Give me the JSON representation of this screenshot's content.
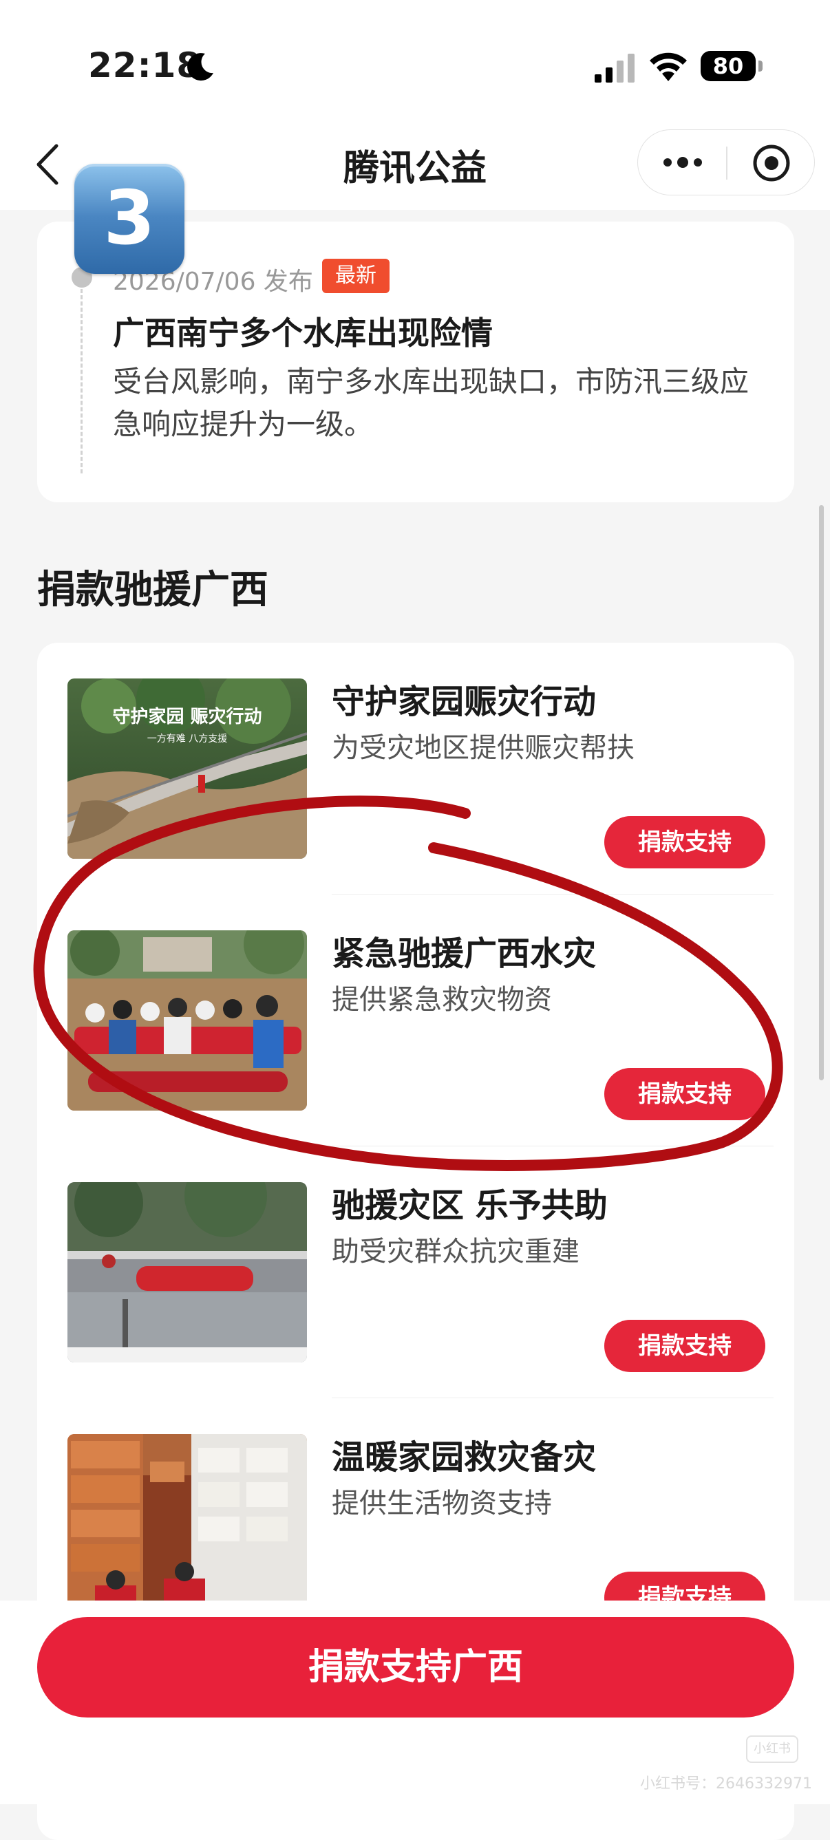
{
  "status_bar": {
    "time": "22:18",
    "battery": "80",
    "icons": [
      "moon-icon",
      "signal-icon",
      "wifi-icon",
      "battery-icon"
    ]
  },
  "nav": {
    "title": "腾讯公益",
    "icons": [
      "back-icon",
      "more-icon",
      "close-icon"
    ]
  },
  "step_badge": "3",
  "news": {
    "date": "2026/07/06 发布",
    "tag": "最新",
    "title": "广西南宁多个水库出现险情",
    "description": "受台风影响，南宁多水库出现缺口，市防汛三级应急响应提升为一级。"
  },
  "section": {
    "title": "捐款驰援广西"
  },
  "projects": [
    {
      "title": "守护家园赈灾行动",
      "subtitle": "为受灾地区提供赈灾帮扶",
      "button": "捐款支持",
      "thumb_caption": "守护家园 赈灾行动",
      "thumb_subcaption": "一方有难 八方支援"
    },
    {
      "title": "紧急驰援广西水灾",
      "subtitle": "提供紧急救灾物资",
      "button": "捐款支持"
    },
    {
      "title": "驰援灾区 乐予共助",
      "subtitle": "助受灾群众抗灾重建",
      "button": "捐款支持"
    },
    {
      "title": "温暖家园救灾备灾",
      "subtitle": "提供生活物资支持",
      "button": "捐款支持"
    }
  ],
  "bottom": {
    "button": "捐款支持广西",
    "watermark_logo": "小红书",
    "watermark_text": "小红书号：2646332971"
  },
  "colors": {
    "primary_red": "#e8213a",
    "tag_orange": "#f04d2e",
    "annotation_red": "#b00d12",
    "badge_blue": "#4a86c2"
  }
}
